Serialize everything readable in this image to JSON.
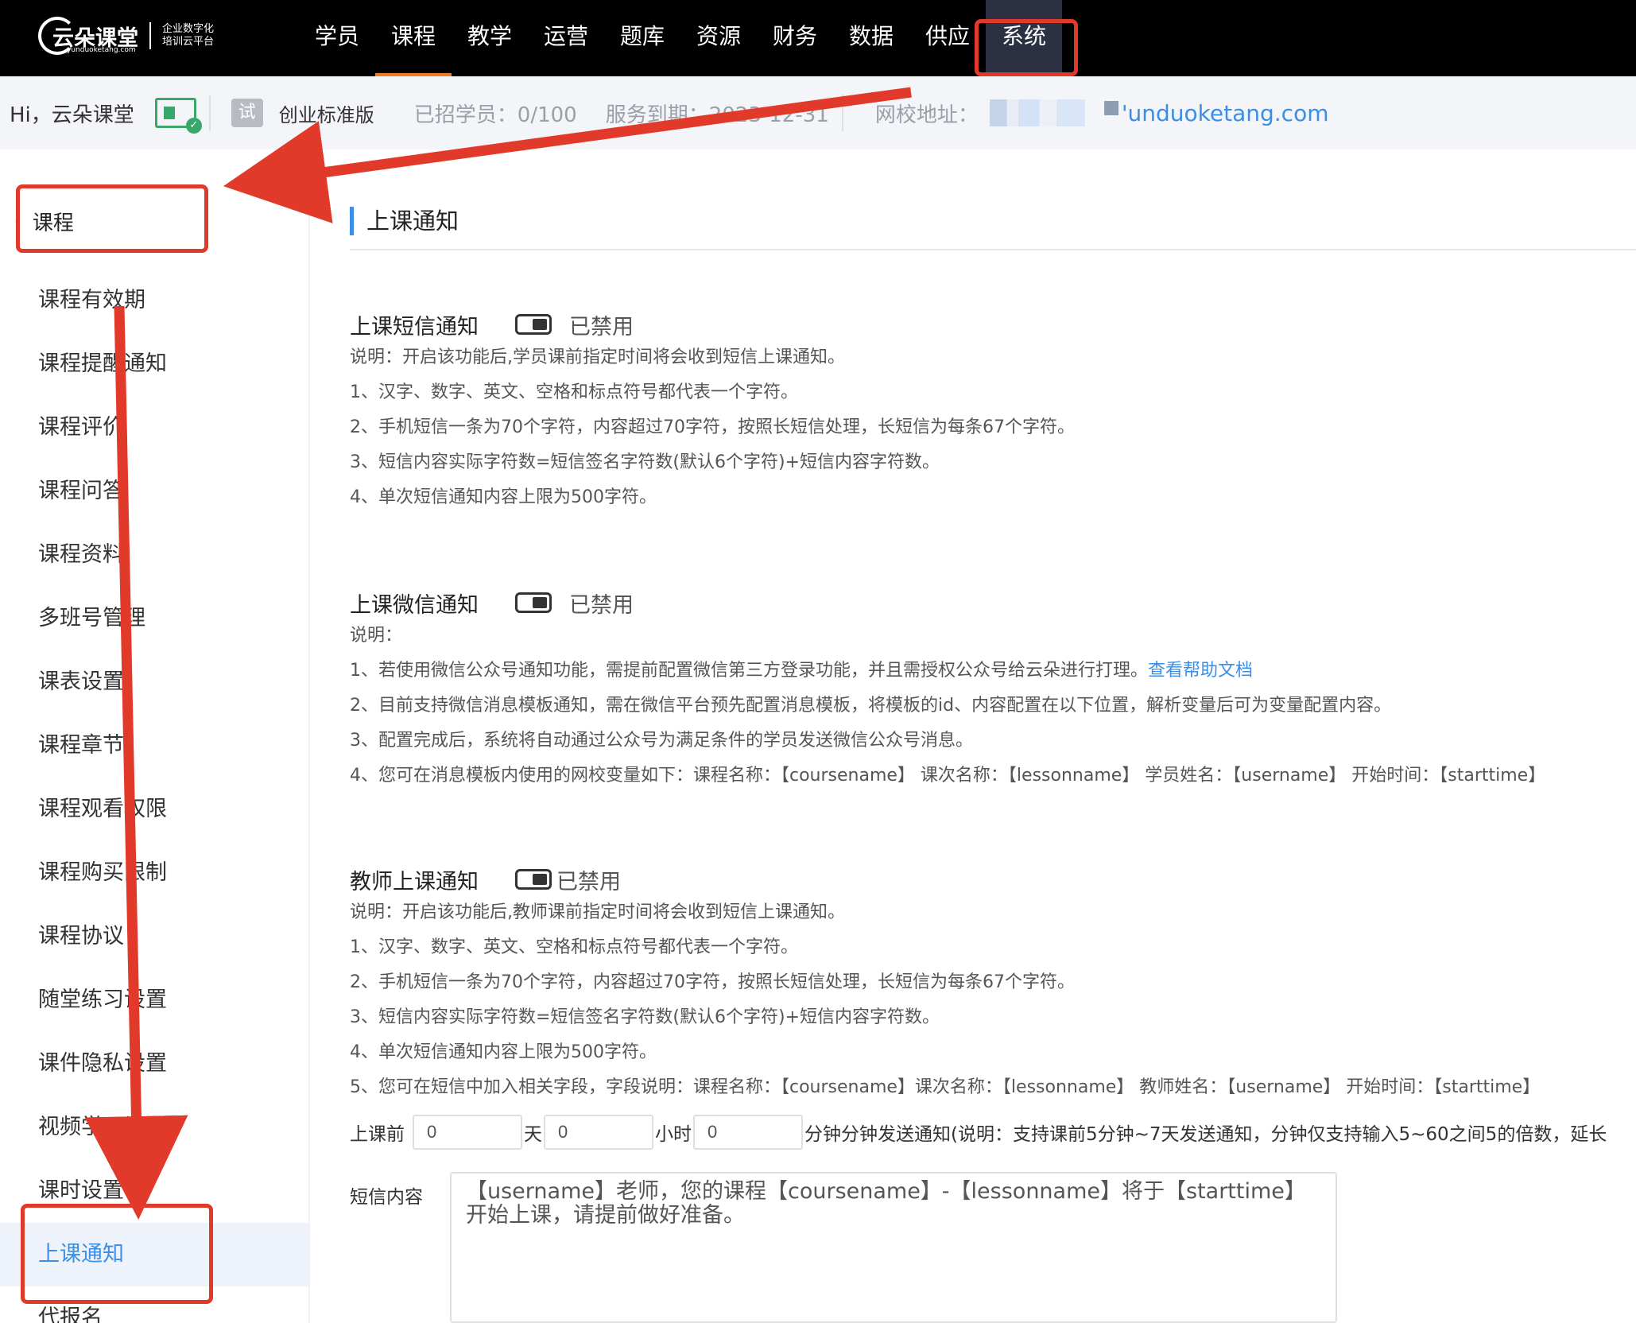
{
  "brand": {
    "name": "云朵课堂",
    "domain": "yunduoketang.com",
    "slogan_line1": "企业数字化",
    "slogan_line2": "培训云平台"
  },
  "nav": [
    "学员",
    "课程",
    "教学",
    "运营",
    "题库",
    "资源",
    "财务",
    "数据",
    "供应",
    "系统"
  ],
  "nav_selected": "课程",
  "nav_highlighted": "系统",
  "infobar": {
    "greeting": "Hi，云朵课堂",
    "trial_badge": "试",
    "edition": "创业标准版",
    "students": "已招学员：0/100",
    "expire": "服务到期：2023-12-31",
    "school_label": "网校地址：",
    "school_url": "'unduoketang.com"
  },
  "sidebar": {
    "header": "课程",
    "items": [
      "课程有效期",
      "课程提醒通知",
      "课程评价",
      "课程问答",
      "课程资料",
      "多班号管理",
      "课表设置",
      "课程章节",
      "课程观看权限",
      "课程购买限制",
      "课程协议",
      "随堂练习设置",
      "课件隐私设置",
      "视频学习设置",
      "课时设置",
      "上课通知",
      "代报名"
    ],
    "active": "上课通知"
  },
  "page": {
    "title": "上课通知",
    "sms": {
      "title": "上课短信通知",
      "status": "已禁用",
      "lines": [
        "说明：开启该功能后,学员课前指定时间将会收到短信上课通知。",
        "1、汉字、数字、英文、空格和标点符号都代表一个字符。",
        "2、手机短信一条为70个字符，内容超过70字符，按照长短信处理，长短信为每条67个字符。",
        "3、短信内容实际字符数=短信签名字符数(默认6个字符)+短信内容字符数。",
        "4、单次短信通知内容上限为500字符。"
      ]
    },
    "wechat": {
      "title": "上课微信通知",
      "status": "已禁用",
      "lines": [
        "说明：",
        "1、若使用微信公众号通知功能，需提前配置微信第三方登录功能，并且需授权公众号给云朵进行打理。",
        "2、目前支持微信消息模板通知，需在微信平台预先配置消息模板，将模板的id、内容配置在以下位置，解析变量后可为变量配置内容。",
        "3、配置完成后，系统将自动通过公众号为满足条件的学员发送微信公众号消息。",
        "4、您可在消息模板内使用的网校变量如下：课程名称：【coursename】 课次名称：【lessonname】 学员姓名：【username】 开始时间：【starttime】"
      ],
      "help_link": "查看帮助文档"
    },
    "teacher": {
      "title": "教师上课通知",
      "status": "已禁用",
      "lines": [
        "说明：开启该功能后,教师课前指定时间将会收到短信上课通知。",
        "1、汉字、数字、英文、空格和标点符号都代表一个字符。",
        "2、手机短信一条为70个字符，内容超过70字符，按照长短信处理，长短信为每条67个字符。",
        "3、短信内容实际字符数=短信签名字符数(默认6个字符)+短信内容字符数。",
        "4、单次短信通知内容上限为500字符。",
        "5、您可在短信中加入相关字段，字段说明：课程名称：【coursename】课次名称：【lessonname】 教师姓名：【username】 开始时间：【starttime】"
      ]
    },
    "send": {
      "before_label": "上课前",
      "days_value": "0",
      "days_unit": "天",
      "hours_value": "0",
      "hours_unit": "小时",
      "minutes_value": "0",
      "tail": "分钟分钟发送通知(说明：支持课前5分钟~7天发送通知，分钟仅支持输入5~60之间5的倍数，延长"
    },
    "sms_content": {
      "label": "短信内容",
      "text": "【username】老师，您的课程【coursename】-【lessonname】将于【starttime】开始上课，请提前做好准备。"
    }
  },
  "colors": {
    "accent": "#3a8ee6",
    "nav_indicator": "#f07b24",
    "annotation": "#e23a2a"
  }
}
